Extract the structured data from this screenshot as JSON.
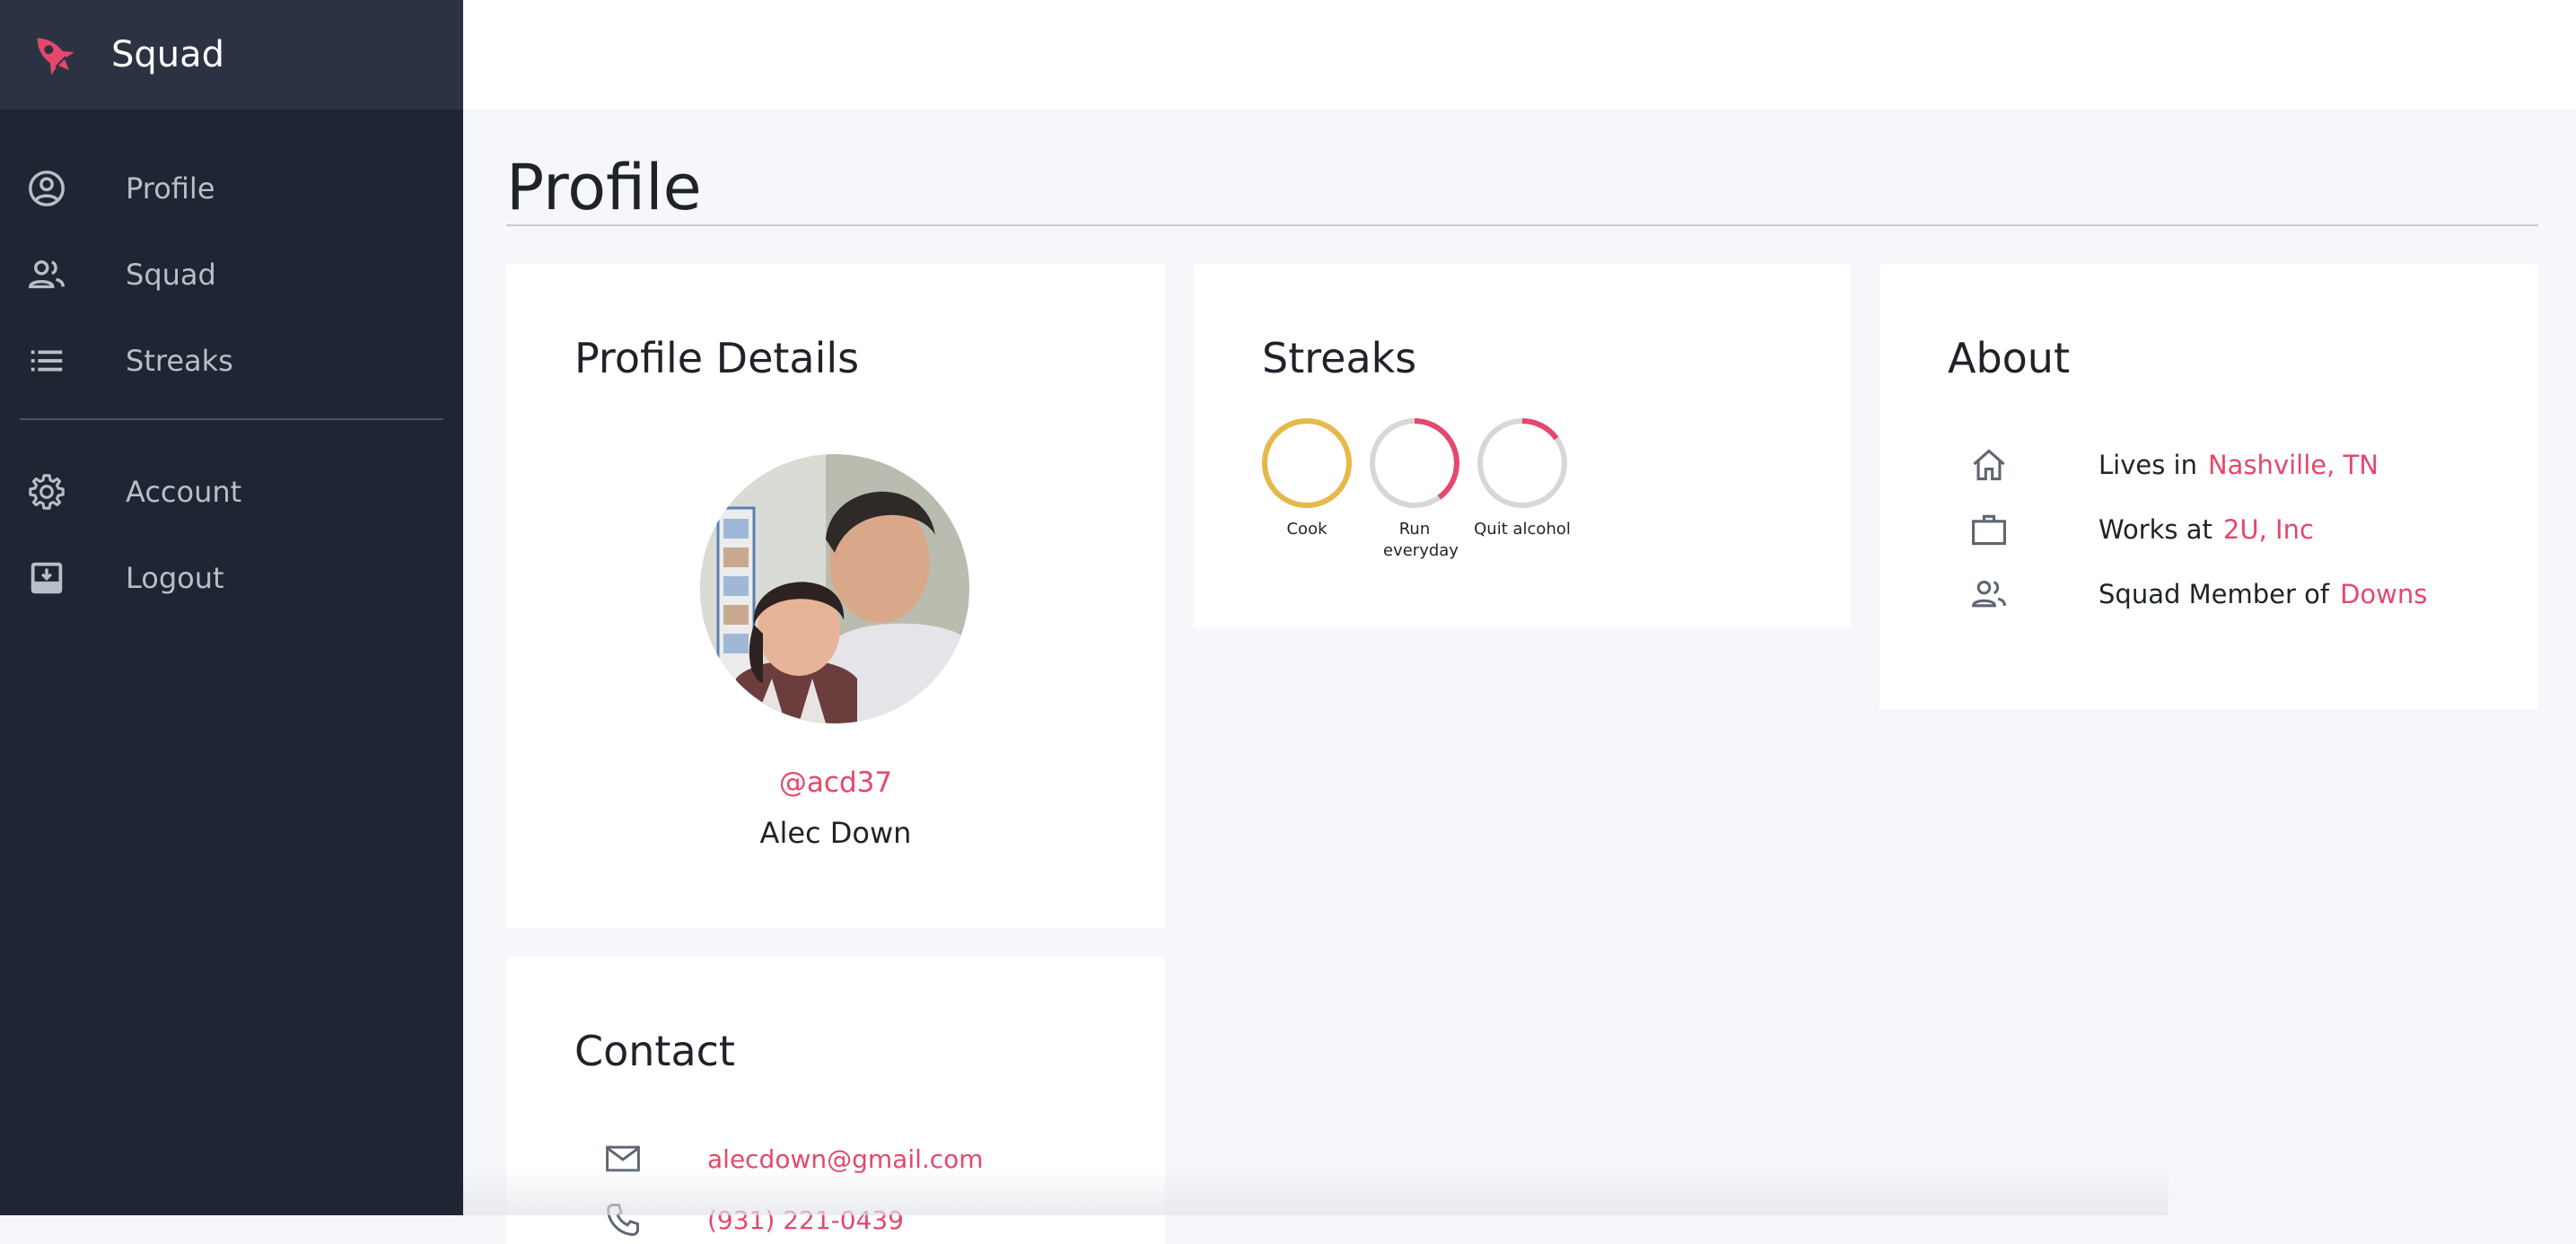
{
  "app": {
    "name": "Squad",
    "accent": "#e6476b",
    "sidebar_bg": "#1e2533"
  },
  "sidebar": {
    "items": [
      {
        "label": "Profile",
        "icon": "account-circle-icon"
      },
      {
        "label": "Squad",
        "icon": "people-icon"
      },
      {
        "label": "Streaks",
        "icon": "list-icon"
      },
      {
        "label": "Account",
        "icon": "gear-icon"
      },
      {
        "label": "Logout",
        "icon": "logout-tray-icon"
      }
    ]
  },
  "page": {
    "title": "Profile"
  },
  "profile_details": {
    "title": "Profile Details",
    "handle": "@acd37",
    "name": "Alec Down"
  },
  "streaks": {
    "title": "Streaks",
    "items": [
      {
        "label": "Cook",
        "progress": 1.0,
        "color": "#e6b948"
      },
      {
        "label": "Run everyday",
        "progress": 0.4,
        "color": "#e6476b"
      },
      {
        "label": "Quit alcohol",
        "progress": 0.15,
        "color": "#e6476b"
      }
    ]
  },
  "about": {
    "title": "About",
    "rows": [
      {
        "icon": "home-icon",
        "text": "Lives in",
        "link": "Nashville, TN"
      },
      {
        "icon": "briefcase-icon",
        "text": "Works at",
        "link": "2U, Inc"
      },
      {
        "icon": "people-icon",
        "text": "Squad Member of",
        "link": "Downs"
      }
    ]
  },
  "contact": {
    "title": "Contact",
    "rows": [
      {
        "icon": "mail-icon",
        "value": "alecdown@gmail.com"
      },
      {
        "icon": "phone-icon",
        "value": "(931) 221-0439"
      }
    ]
  }
}
